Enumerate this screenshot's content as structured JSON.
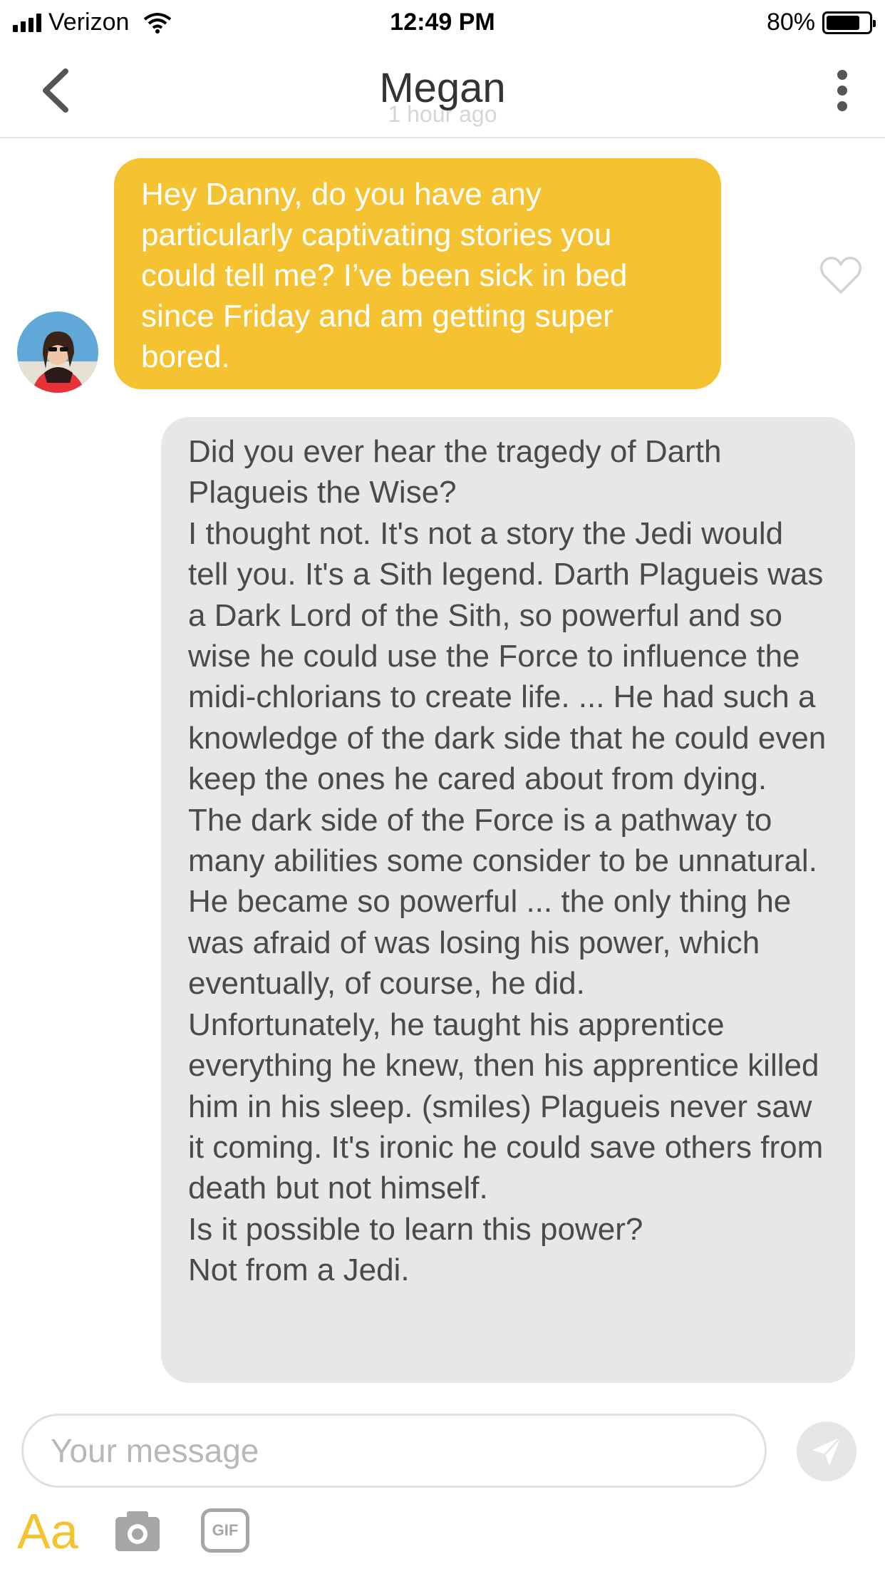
{
  "status_bar": {
    "carrier": "Verizon",
    "time": "12:49 PM",
    "battery": "80%",
    "battery_level": 0.8
  },
  "header": {
    "title": "Megan",
    "subtitle": "1 hour ago",
    "back_icon": "chevron-left-icon",
    "menu_icon": "more-vertical-icon"
  },
  "messages": {
    "outgoing": {
      "text": "Hey Danny, do you have any particularly captivating stories you could tell me? I’ve been sick in bed since Friday and am getting super bored."
    },
    "incoming": {
      "lines": [
        "Did you ever hear the tragedy of Darth Plagueis the Wise?",
        "I thought not. It's not a story the Jedi would tell you. It's a Sith legend. Darth Plagueis was a Dark Lord of the Sith, so powerful and so wise he could use the Force to influence the midi-chlorians to create life. ... He had such a knowledge of the dark side that he could even keep the ones he cared about from dying.",
        "The dark side of the Force is a pathway to many abilities some consider to be unnatural.",
        "He became so powerful ... the only thing he was afraid of was losing his power, which eventually, of course, he did.",
        "Unfortunately, he taught his apprentice everything he knew, then his apprentice killed him in his sleep. (smiles) Plagueis never saw it coming. It's ironic he could save others from death but not himself.",
        "Is it possible to learn this power?",
        "Not from a Jedi."
      ]
    }
  },
  "composer": {
    "placeholder": "Your message",
    "value": ""
  },
  "toolbar": {
    "text_style_label": "Aa",
    "gif_label": "GIF"
  },
  "colors": {
    "accent": "#f5c231",
    "incoming_bubble": "#e7e7e7",
    "icon_gray": "#a6a6a6"
  }
}
